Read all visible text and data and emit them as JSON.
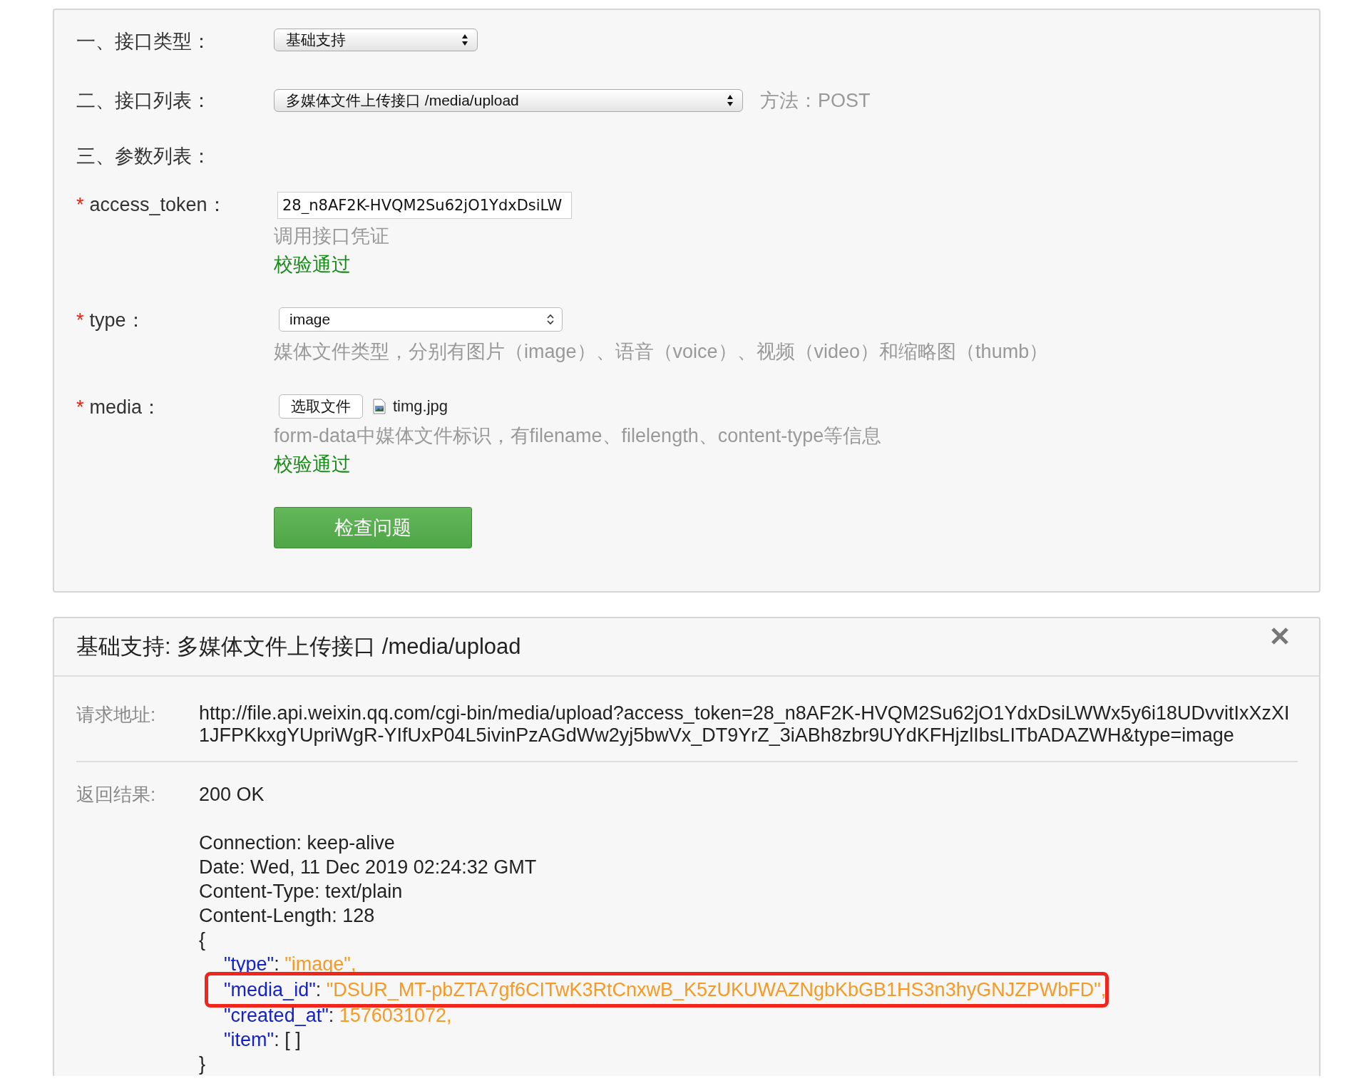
{
  "form": {
    "interface_type": {
      "label": "一、接口类型：",
      "value": "基础支持"
    },
    "interface_list": {
      "label": "二、接口列表：",
      "value": "多媒体文件上传接口 /media/upload",
      "method": "方法：POST"
    },
    "params_heading": "三、参数列表：",
    "params": [
      {
        "kind": "text",
        "required": true,
        "required_mark": "*",
        "name": "access_token：",
        "value": "28_n8AF2K-HVQM2Su62jO1YdxDsiLW",
        "hint": "调用接口凭证",
        "validation": "校验通过"
      },
      {
        "kind": "select",
        "required": true,
        "required_mark": "*",
        "name": "type：",
        "value": "image",
        "hint": "媒体文件类型，分别有图片（image）、语音（voice）、视频（video）和缩略图（thumb）"
      },
      {
        "kind": "file",
        "required": true,
        "required_mark": "*",
        "name": "media：",
        "button": "选取文件",
        "filename": "timg.jpg",
        "hint": "form-data中媒体文件标识，有filename、filelength、content-type等信息",
        "validation": "校验通过"
      }
    ],
    "submit": "检查问题"
  },
  "result": {
    "title": "基础支持: 多媒体文件上传接口 /media/upload",
    "request_label": "请求地址:",
    "request_url": "http://file.api.weixin.qq.com/cgi-bin/media/upload?access_token=28_n8AF2K-HVQM2Su62jO1YdxDsiLWWx5y6i18UDvvitIxXzXI1JFPKkxgYUpriWgR-YIfUxP04L5ivinPzAGdWw2yj5bwVx_DT9YrZ_3iABh8zbr9UYdKFHjzlIbsLITbADAZWH&type=image",
    "response_label": "返回结果:",
    "status": "200 OK",
    "headers": [
      "Connection: keep-alive",
      "Date: Wed, 11 Dec 2019 02:24:32 GMT",
      "Content-Type: text/plain",
      "Content-Length: 128"
    ],
    "body": [
      {
        "indent": false,
        "highlighted": false,
        "parts": [
          {
            "kind": "plain",
            "text": "{"
          }
        ]
      },
      {
        "indent": true,
        "highlighted": false,
        "parts": [
          {
            "kind": "key",
            "text": "\"type\""
          },
          {
            "kind": "plain",
            "text": ": "
          },
          {
            "kind": "value",
            "text": "\"image\","
          }
        ]
      },
      {
        "indent": true,
        "highlighted": true,
        "parts": [
          {
            "kind": "key",
            "text": "\"media_id\""
          },
          {
            "kind": "plain",
            "text": ": "
          },
          {
            "kind": "value",
            "text": "\"DSUR_MT-pbZTA7gf6CITwK3RtCnxwB_K5zUKUWAZNgbKbGB1HS3n3hyGNJZPWbFD\","
          }
        ]
      },
      {
        "indent": true,
        "highlighted": false,
        "parts": [
          {
            "kind": "key",
            "text": "\"created_at\""
          },
          {
            "kind": "plain",
            "text": ": "
          },
          {
            "kind": "value",
            "text": "1576031072,"
          }
        ]
      },
      {
        "indent": true,
        "highlighted": false,
        "parts": [
          {
            "kind": "key",
            "text": "\"item\""
          },
          {
            "kind": "plain",
            "text": ": [ ]"
          }
        ]
      },
      {
        "indent": false,
        "highlighted": false,
        "parts": [
          {
            "kind": "plain",
            "text": "}"
          }
        ]
      }
    ]
  }
}
